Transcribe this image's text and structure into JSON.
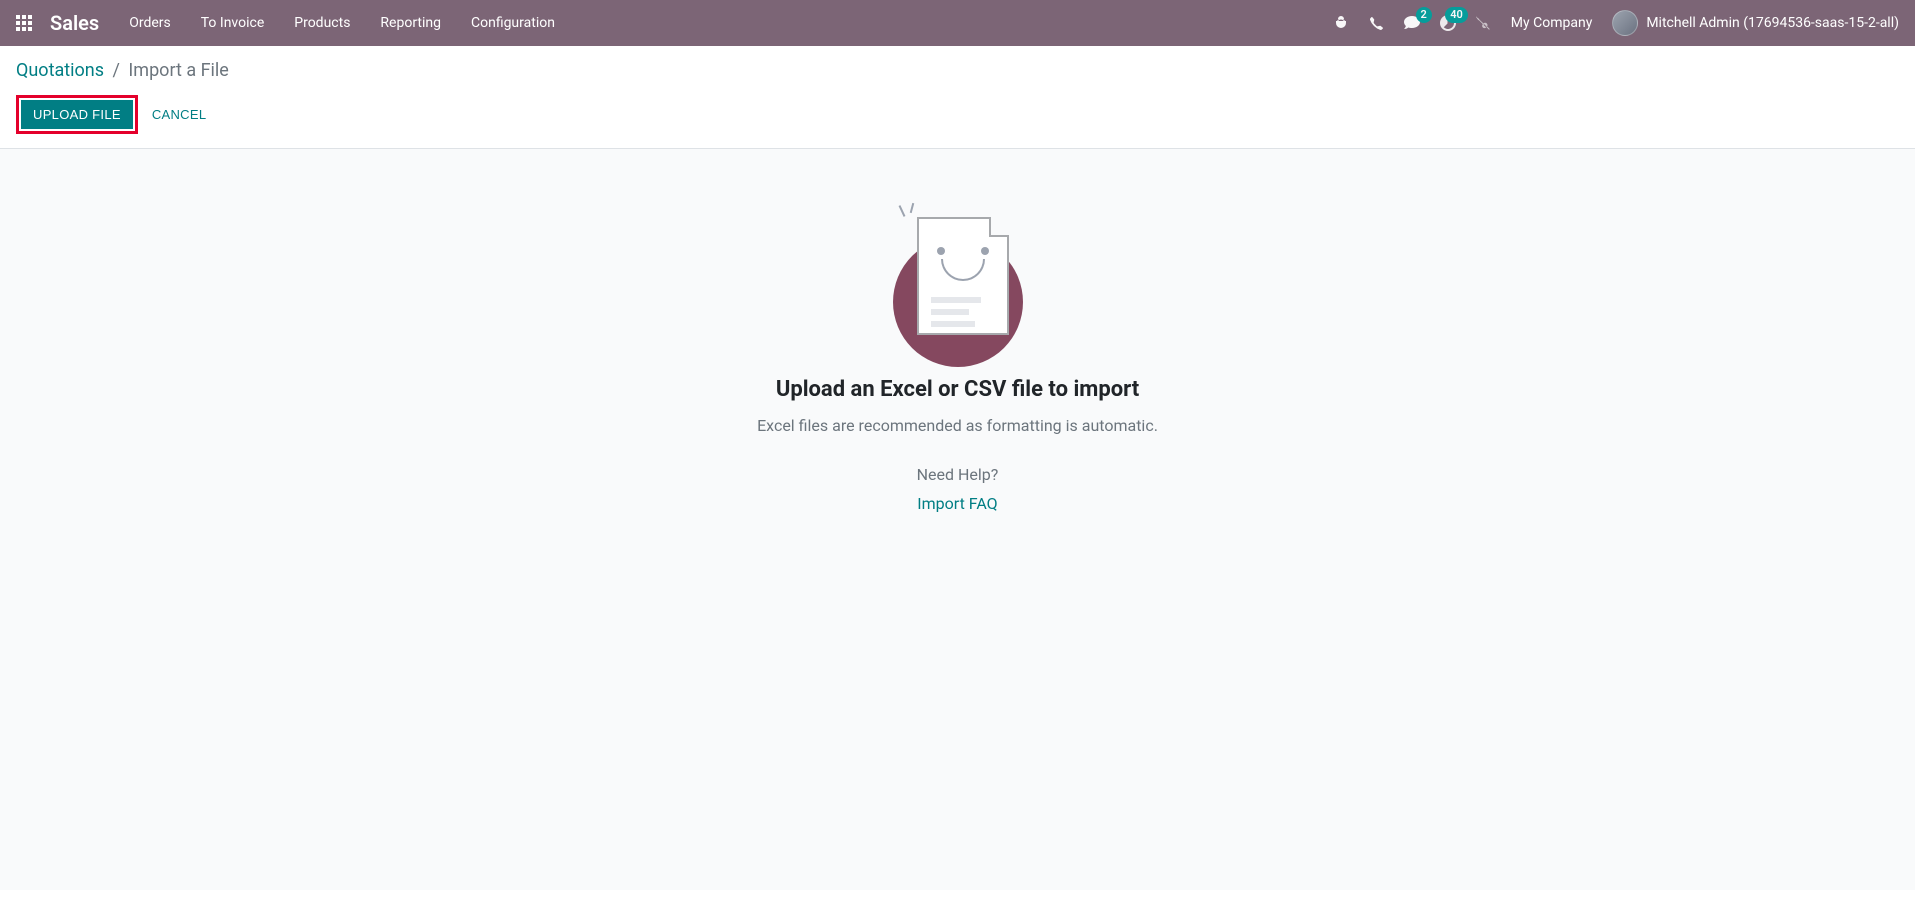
{
  "navbar": {
    "brand": "Sales",
    "menu": [
      "Orders",
      "To Invoice",
      "Products",
      "Reporting",
      "Configuration"
    ],
    "messages_badge": "2",
    "activities_badge": "40",
    "company": "My Company",
    "user": "Mitchell Admin (17694536-saas-15-2-all)"
  },
  "breadcrumb": {
    "parent": "Quotations",
    "current": "Import a File"
  },
  "buttons": {
    "upload": "Upload File",
    "cancel": "Cancel"
  },
  "empty": {
    "title": "Upload an Excel or CSV file to import",
    "subtitle": "Excel files are recommended as formatting is automatic.",
    "help": "Need Help?",
    "link": "Import FAQ"
  }
}
